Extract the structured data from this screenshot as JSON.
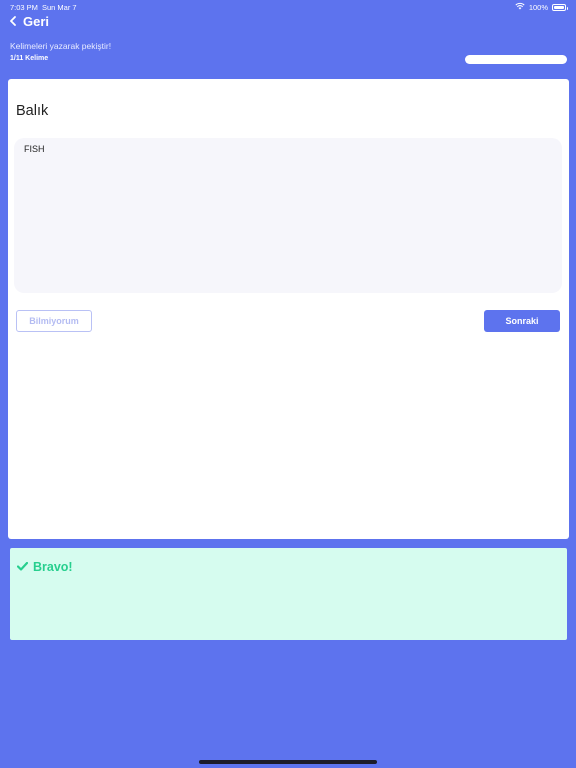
{
  "status_bar": {
    "time": "7:03 PM",
    "date": "Sun Mar 7",
    "battery": "100%",
    "icons": [
      "wifi-icon",
      "battery-icon"
    ]
  },
  "nav": {
    "back_label": "Geri",
    "icon": "chevron-left-icon"
  },
  "header": {
    "subtitle": "Kelimeleri yazarak pekiştir!",
    "progress_label": "1/11 Kelime",
    "progress_fraction": 0.0
  },
  "card": {
    "word": "Balık",
    "answer_value": "FISH",
    "dont_know_label": "Bilmiyorum",
    "next_label": "Sonraki"
  },
  "feedback": {
    "message": "Bravo!",
    "icon": "checkmark-icon"
  },
  "colors": {
    "background": "#5d73ee",
    "primary": "#5d73ee",
    "success_bg": "#d6fcef",
    "success_text": "#27cf8e"
  }
}
